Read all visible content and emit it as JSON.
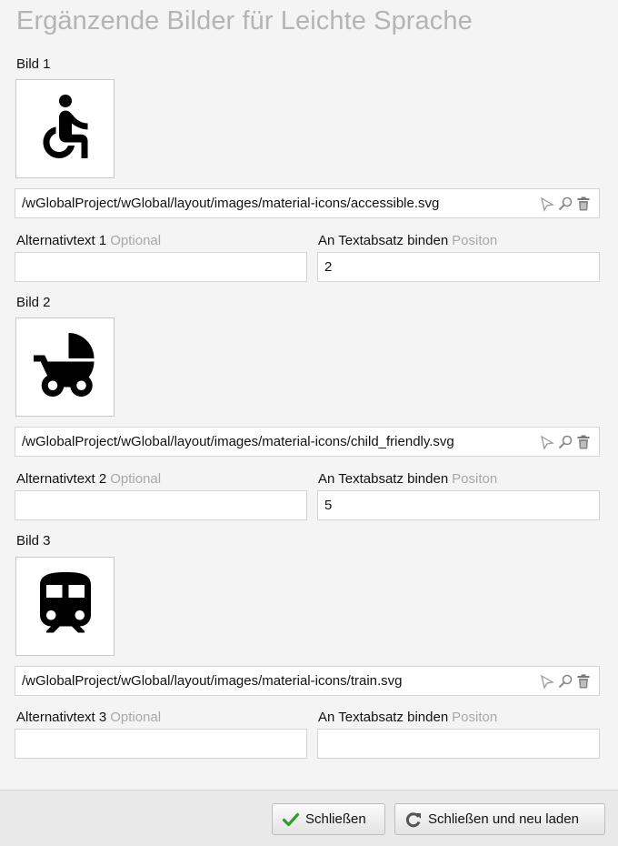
{
  "dialog": {
    "title": "Ergänzende Bilder für Leichte Sprache"
  },
  "images": [
    {
      "label": "Bild 1",
      "icon": "accessible-icon",
      "path": "/wGlobalProject/wGlobal/layout/images/material-icons/accessible.svg",
      "alt_label": "Alternativtext 1",
      "alt_hint": "Optional",
      "alt_value": "",
      "bind_label": "An Textabsatz binden",
      "bind_hint": "Positon",
      "bind_value": "2"
    },
    {
      "label": "Bild 2",
      "icon": "child-friendly-icon",
      "path": "/wGlobalProject/wGlobal/layout/images/material-icons/child_friendly.svg",
      "alt_label": "Alternativtext 2",
      "alt_hint": "Optional",
      "alt_value": "",
      "bind_label": "An Textabsatz binden",
      "bind_hint": "Positon",
      "bind_value": "5"
    },
    {
      "label": "Bild 3",
      "icon": "train-icon",
      "path": "/wGlobalProject/wGlobal/layout/images/material-icons/train.svg",
      "alt_label": "Alternativtext 3",
      "alt_hint": "Optional",
      "alt_value": "",
      "bind_label": "An Textabsatz binden",
      "bind_hint": "Positon",
      "bind_value": ""
    }
  ],
  "footer": {
    "close_label": "Schließen",
    "close_reload_label": "Schließen und neu laden"
  },
  "colors": {
    "check_green": "#2e9e2e",
    "reload_gray": "#555555"
  }
}
